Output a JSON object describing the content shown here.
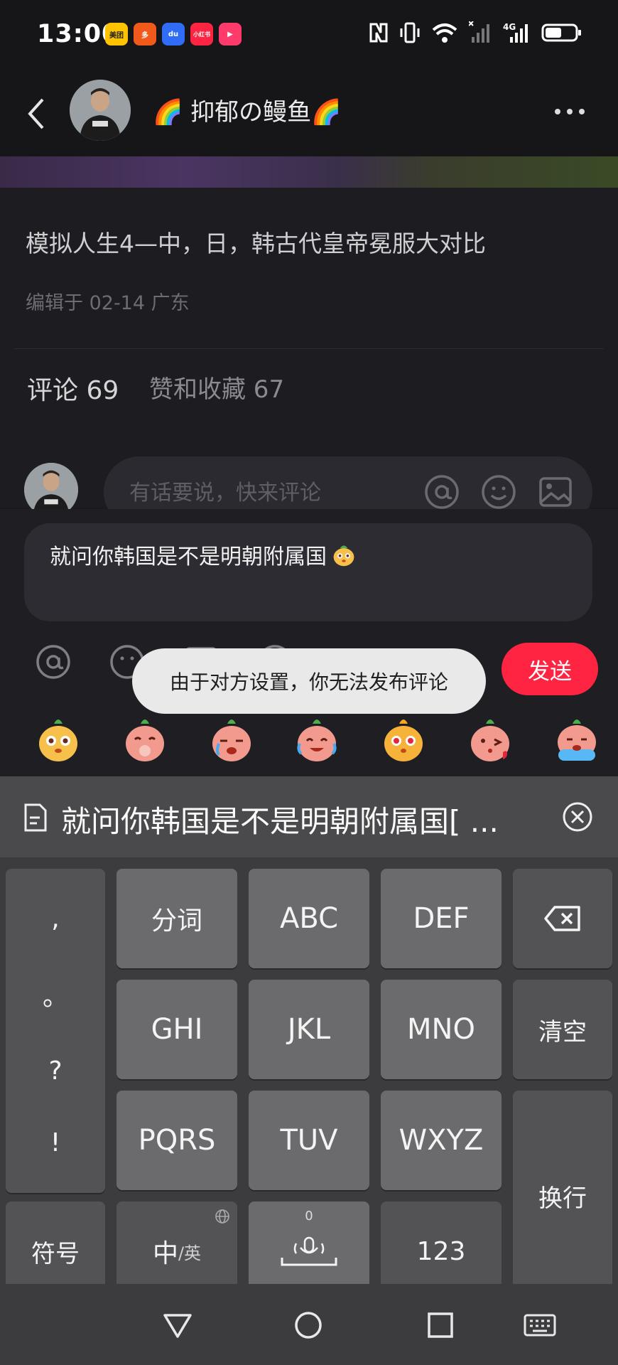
{
  "status_bar": {
    "time": "13:00",
    "app_badges": [
      {
        "label": "美团",
        "color": "#ffc300",
        "text_color": "#222"
      },
      {
        "label": "多",
        "color": "#f25a1b",
        "text_color": "#fff"
      },
      {
        "label": "du",
        "color": "#2f6df6",
        "text_color": "#fff"
      },
      {
        "label": "小红书",
        "color": "#ff2442",
        "text_color": "#fff"
      },
      {
        "label": "▶",
        "color": "#ff3b6b",
        "text_color": "#fff"
      }
    ]
  },
  "header": {
    "username": "🌈 抑郁の鳗鱼🌈"
  },
  "post": {
    "title": "模拟人生4—中，日，韩古代皇帝冕服大对比",
    "meta": "编辑于 02-14 广东",
    "tab_comments": "评论 69",
    "tab_likes": "赞和收藏 67",
    "comment_placeholder": "有话要说，快来评论"
  },
  "composer": {
    "text": "就问你韩国是不是明朝附属国",
    "send_label": "发送",
    "toast": "由于对方设置，你无法发布评论"
  },
  "keyboard": {
    "suggestion": "就问你韩国是不是明朝附属国[ ...",
    "punct": [
      ",",
      "。",
      "?",
      "!"
    ],
    "row1": [
      "分词",
      "ABC",
      "DEF"
    ],
    "row2": [
      "GHI",
      "JKL",
      "MNO"
    ],
    "row3": [
      "PQRS",
      "TUV",
      "WXYZ"
    ],
    "clear": "清空",
    "enter": "换行",
    "symbols": "符号",
    "lang_main": "中",
    "lang_sub": "/英",
    "space_hint": "0",
    "numbers": "123"
  },
  "colors": {
    "accent": "#ff2442"
  }
}
